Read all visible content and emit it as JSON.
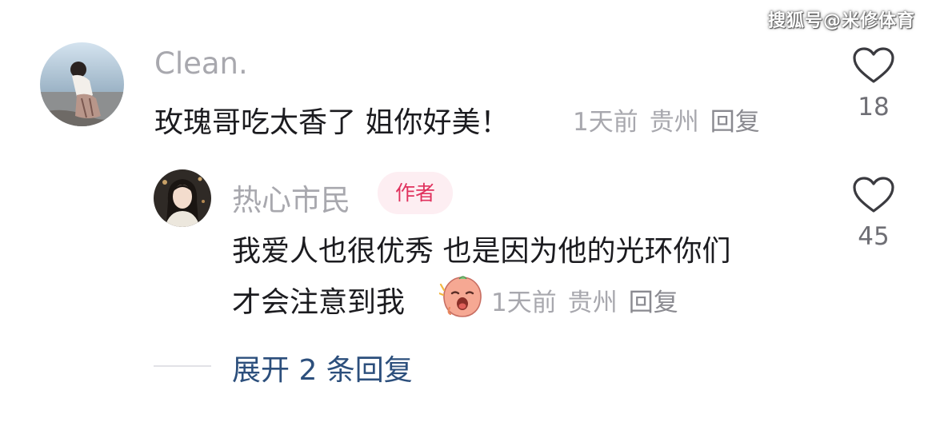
{
  "watermark": "搜狐号@米修体育",
  "comment": {
    "username": "Clean.",
    "text": "玫瑰哥吃太香了 姐你好美！",
    "time": "1天前",
    "location": "贵州",
    "reply_label": "回复",
    "likes": "18"
  },
  "reply": {
    "username": "热心市民",
    "badge": "作者",
    "text_line1": "我爱人也很优秀 也是因为他的光环你们",
    "text_line2": "才会注意到我",
    "time": "1天前",
    "location": "贵州",
    "reply_label": "回复",
    "likes": "45"
  },
  "expand_replies": "展开 2 条回复",
  "colors": {
    "username": "#a8a8ae",
    "text": "#1b1b1f",
    "meta": "#a8a8ae",
    "badge_text": "#e0325e",
    "badge_bg": "#fdeef2",
    "expand_link": "#2c4f7c"
  },
  "icons": {
    "like": "heart-outline-icon",
    "emoji": "crying-face-emoji"
  }
}
